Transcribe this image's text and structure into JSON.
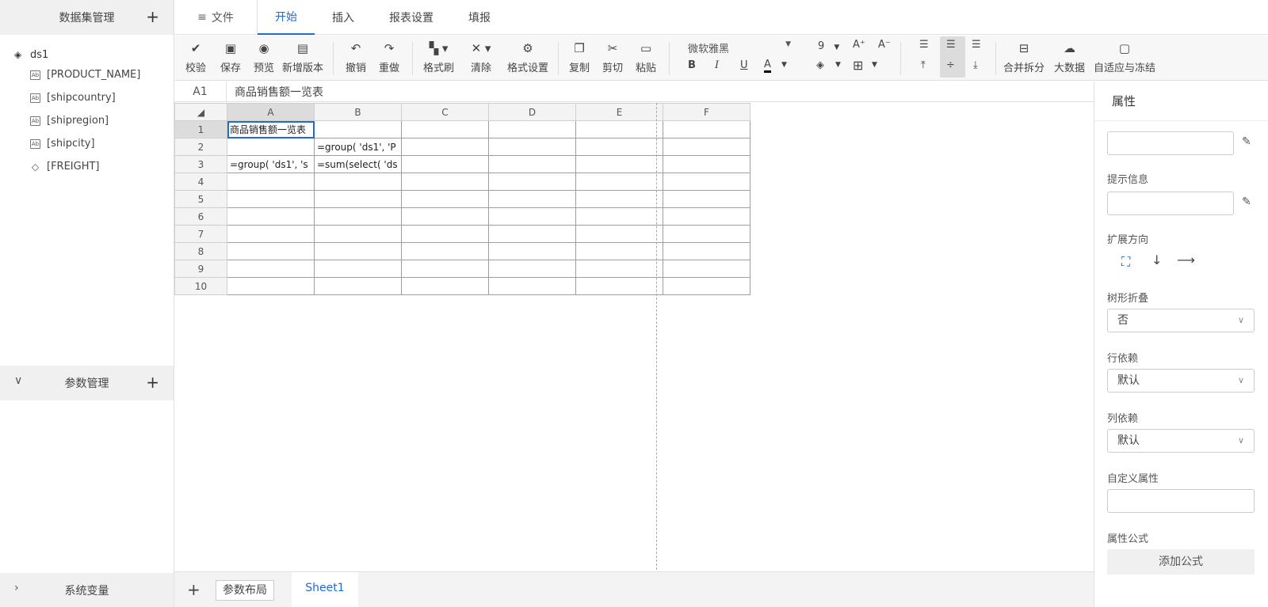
{
  "sidebar": {
    "dataset_title": "数据集管理",
    "add_label": "+",
    "root": "ds1",
    "fields": [
      "[PRODUCT_NAME]",
      "[shipcountry]",
      "[shipregion]",
      "[shipcity]",
      "[FREIGHT]"
    ],
    "param_title": "参数管理",
    "sys_title": "系统变量"
  },
  "topbar": {
    "file_label": "文件",
    "tabs": [
      "开始",
      "插入",
      "报表设置",
      "填报"
    ],
    "active_tab": "开始"
  },
  "toolbar": {
    "verify": "校验",
    "save": "保存",
    "preview": "预览",
    "new_version": "新增版本",
    "undo": "撤销",
    "redo": "重做",
    "format_brush": "格式刷",
    "clear": "清除",
    "format_settings": "格式设置",
    "copy": "复制",
    "cut": "剪切",
    "paste": "粘贴",
    "font_name": "微软雅黑",
    "font_size": "9",
    "merge_split": "合并拆分",
    "big_data": "大数据",
    "adaptive_freeze": "自适应与冻结"
  },
  "formula_bar": {
    "cell_ref": "A1",
    "content": "商品销售额一览表"
  },
  "sheet": {
    "columns": [
      "A",
      "B",
      "C",
      "D",
      "E",
      "F"
    ],
    "rows": [
      "1",
      "2",
      "3",
      "4",
      "5",
      "6",
      "7",
      "8",
      "9",
      "10"
    ],
    "cells": {
      "A1": "商品销售额一览表",
      "B2": "=group( 'ds1', 'P",
      "A3": "=group( 'ds1', 's",
      "B3": "=sum(select( 'ds"
    }
  },
  "bottom": {
    "add": "+",
    "param_layout": "参数布局",
    "sheet_name": "Sheet1"
  },
  "props": {
    "title": "属性",
    "tip_label": "提示信息",
    "expand_label": "扩展方向",
    "tree_fold_label": "树形折叠",
    "tree_fold_value": "否",
    "row_dep_label": "行依赖",
    "row_dep_value": "默认",
    "col_dep_label": "列依赖",
    "col_dep_value": "默认",
    "custom_label": "自定义属性",
    "formula_label": "属性公式",
    "add_formula": "添加公式"
  },
  "colors": {
    "accent": "#1e6ad6"
  }
}
